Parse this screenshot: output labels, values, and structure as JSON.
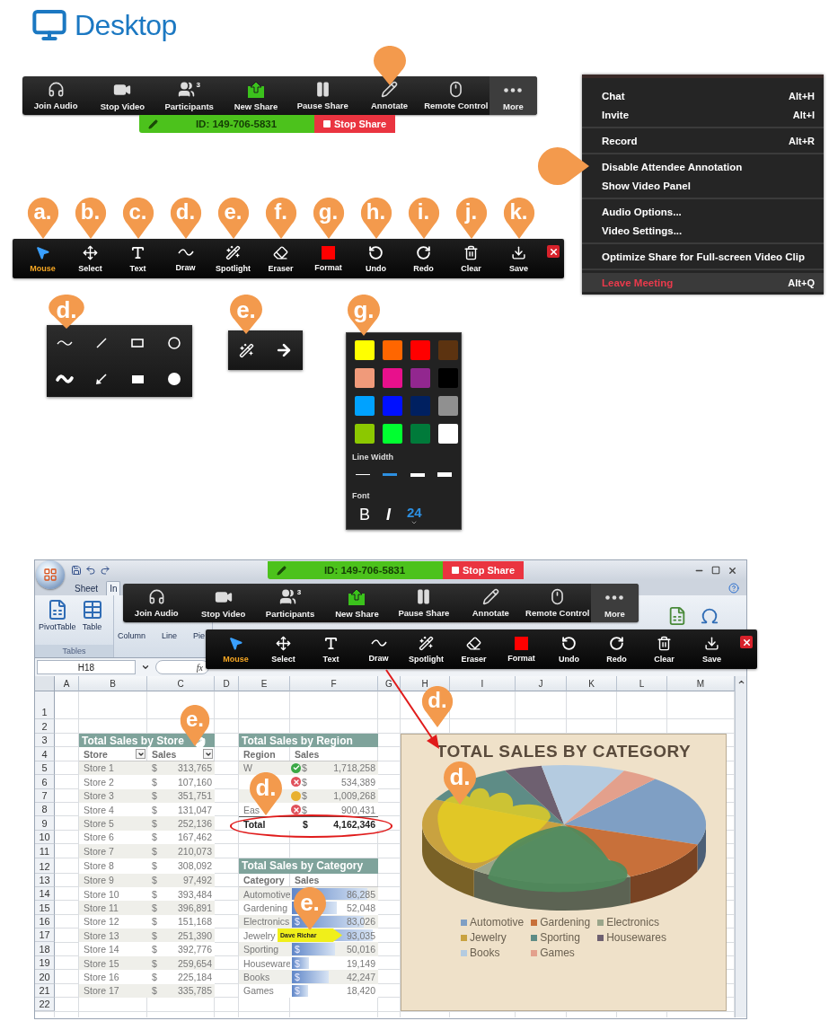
{
  "header": {
    "title": "Desktop"
  },
  "meeting_toolbar": {
    "buttons": [
      {
        "kind": "audio",
        "label": "Join Audio",
        "active": false,
        "marked": false
      },
      {
        "kind": "video",
        "label": "Stop Video",
        "active": false,
        "marked": false
      },
      {
        "kind": "participants",
        "label": "Participants",
        "count": "3",
        "active": false,
        "marked": false
      },
      {
        "kind": "share",
        "label": "New Share",
        "active": false,
        "marked": false
      },
      {
        "kind": "pause",
        "label": "Pause Share",
        "active": false,
        "marked": false
      },
      {
        "kind": "annotate",
        "label": "Annotate",
        "active": false,
        "marked": true
      },
      {
        "kind": "remote",
        "label": "Remote Control",
        "active": false,
        "marked": false
      },
      {
        "kind": "more",
        "label": "More",
        "active": true,
        "marked": false
      }
    ]
  },
  "share_bar": {
    "meeting_id": "ID: 149-706-5831",
    "stop_label": "Stop Share"
  },
  "more_menu": {
    "groups": [
      [
        {
          "label": "Chat",
          "shortcut": "Alt+H",
          "kind": "normal",
          "marked": false
        },
        {
          "label": "Invite",
          "shortcut": "Alt+I",
          "kind": "normal",
          "marked": false
        }
      ],
      [
        {
          "label": "Record",
          "shortcut": "Alt+R",
          "kind": "normal",
          "marked": false
        }
      ],
      [
        {
          "label": "Disable Attendee Annotation",
          "kind": "normal",
          "marked": true
        },
        {
          "label": "Show Video Panel",
          "kind": "normal",
          "marked": false
        }
      ],
      [
        {
          "label": "Audio Options...",
          "kind": "normal",
          "marked": false
        },
        {
          "label": "Video Settings...",
          "kind": "normal",
          "marked": false
        }
      ],
      [
        {
          "label": "Optimize Share for Full-screen Video Clip",
          "kind": "normal",
          "marked": false
        }
      ],
      [
        {
          "label": "Leave Meeting",
          "shortcut": "Alt+Q",
          "kind": "danger",
          "marked": false
        }
      ]
    ]
  },
  "annotation_toolbar": {
    "tools": [
      {
        "kind": "mouse",
        "label": "Mouse",
        "callout": "a.",
        "selected": true
      },
      {
        "kind": "select",
        "label": "Select",
        "callout": "b.",
        "selected": false
      },
      {
        "kind": "text",
        "label": "Text",
        "callout": "c.",
        "selected": false
      },
      {
        "kind": "draw",
        "label": "Draw",
        "callout": "d.",
        "selected": false
      },
      {
        "kind": "spotlight",
        "label": "Spotlight",
        "callout": "e.",
        "selected": false
      },
      {
        "kind": "eraser",
        "label": "Eraser",
        "callout": "f.",
        "selected": false
      },
      {
        "kind": "format",
        "label": "Format",
        "callout": "g.",
        "selected": false
      },
      {
        "kind": "undo",
        "label": "Undo",
        "callout": "h.",
        "selected": false
      },
      {
        "kind": "redo",
        "label": "Redo",
        "callout": "i.",
        "selected": false
      },
      {
        "kind": "clear",
        "label": "Clear",
        "callout": "j.",
        "selected": false
      },
      {
        "kind": "save",
        "label": "Save",
        "callout": "k.",
        "selected": false
      }
    ]
  },
  "draw_panel": {
    "callout": "d.",
    "tools": [
      {
        "kind": "wave"
      },
      {
        "kind": "line"
      },
      {
        "kind": "rectangle"
      },
      {
        "kind": "ellipse"
      },
      {
        "kind": "wave-filled"
      },
      {
        "kind": "arrow"
      },
      {
        "kind": "rectangle-filled"
      },
      {
        "kind": "ellipse-filled"
      }
    ]
  },
  "spotlight_panel": {
    "callout": "e.",
    "tools": [
      {
        "kind": "spotlight"
      },
      {
        "kind": "arrow"
      }
    ]
  },
  "format_panel": {
    "callout": "g.",
    "colors": [
      {
        "color": "#ffff00"
      },
      {
        "color": "#ff6600"
      },
      {
        "color": "#ff0000"
      },
      {
        "color": "#5c3310"
      },
      {
        "color": "#f09a7a"
      },
      {
        "color": "#e8108c"
      },
      {
        "color": "#92278f"
      },
      {
        "color": "#000000"
      },
      {
        "color": "#00a2ff"
      },
      {
        "color": "#0010ff"
      },
      {
        "color": "#002060"
      },
      {
        "color": "#909090"
      },
      {
        "color": "#8cc800"
      },
      {
        "color": "#00ff30"
      },
      {
        "color": "#007a3a"
      },
      {
        "color": "#ffffff"
      }
    ],
    "line_width_label": "Line Width",
    "line_widths": [
      {
        "selected": false
      },
      {
        "selected": true
      },
      {
        "selected": false
      },
      {
        "selected": false
      }
    ],
    "font_label": "Font",
    "bold": "B",
    "italic": "I",
    "size": "24"
  },
  "spreadsheet": {
    "share_bar": {
      "meeting_id": "ID: 149-706-5831",
      "stop_label": "Stop Share"
    },
    "tabs": [
      {
        "label": "Sheet",
        "selected": false
      },
      {
        "label": "In",
        "selected": true
      }
    ],
    "ribbon": {
      "buttons": [
        {
          "kind": "pivot",
          "label": "PivotTable"
        },
        {
          "kind": "table",
          "label": "Table"
        }
      ],
      "group_label": "Tables",
      "chart_buttons": [
        "Column",
        "Line",
        "Pie"
      ]
    },
    "meeting_toolbar": {
      "buttons": [
        {
          "kind": "audio",
          "label": "Join Audio",
          "active": false,
          "marked": false
        },
        {
          "kind": "video",
          "label": "Stop Video",
          "active": false,
          "marked": false
        },
        {
          "kind": "participants",
          "label": "Participants",
          "count": "3",
          "active": false,
          "marked": false
        },
        {
          "kind": "share",
          "label": "New Share",
          "active": false,
          "marked": false
        },
        {
          "kind": "pause",
          "label": "Pause Share",
          "active": false,
          "marked": false
        },
        {
          "kind": "annotate",
          "label": "Annotate",
          "active": false,
          "marked": false
        },
        {
          "kind": "remote",
          "label": "Remote Control",
          "active": false,
          "marked": false
        },
        {
          "kind": "more",
          "label": "More",
          "active": true,
          "marked": false
        }
      ]
    },
    "annotation_toolbar": {
      "tools": [
        {
          "kind": "mouse",
          "label": "Mouse",
          "selected": true
        },
        {
          "kind": "select",
          "label": "Select",
          "selected": false
        },
        {
          "kind": "text",
          "label": "Text",
          "selected": false
        },
        {
          "kind": "draw",
          "label": "Draw",
          "selected": false
        },
        {
          "kind": "spotlight",
          "label": "Spotlight",
          "selected": false
        },
        {
          "kind": "eraser",
          "label": "Eraser",
          "selected": false
        },
        {
          "kind": "format",
          "label": "Format",
          "selected": false
        },
        {
          "kind": "undo",
          "label": "Undo",
          "selected": false
        },
        {
          "kind": "redo",
          "label": "Redo",
          "selected": false
        },
        {
          "kind": "clear",
          "label": "Clear",
          "selected": false
        },
        {
          "kind": "save",
          "label": "Save",
          "selected": false
        }
      ]
    },
    "name_box": "H18",
    "formula_label": "fx",
    "columns": [
      "A",
      "B",
      "C",
      "D",
      "E",
      "F",
      "G",
      "H",
      "I",
      "J",
      "K",
      "L",
      "M"
    ],
    "rows": [
      "1",
      "2",
      "3",
      "4",
      "5",
      "6",
      "7",
      "8",
      "9",
      "10",
      "11",
      "12",
      "13",
      "14",
      "15",
      "16",
      "17",
      "18",
      "19",
      "20",
      "21",
      "22"
    ],
    "store_table": {
      "title": "Total Sales by Store",
      "callout": "e.",
      "headers": [
        "Store",
        "Sales"
      ],
      "rows": [
        {
          "name": "Store 1",
          "currency": "$",
          "value": "313,765"
        },
        {
          "name": "Store 2",
          "currency": "$",
          "value": "107,160"
        },
        {
          "name": "Store 3",
          "currency": "$",
          "value": "351,751"
        },
        {
          "name": "Store 4",
          "currency": "$",
          "value": "131,047"
        },
        {
          "name": "Store 5",
          "currency": "$",
          "value": "252,136"
        },
        {
          "name": "Store 6",
          "currency": "$",
          "value": "167,462"
        },
        {
          "name": "Store 7",
          "currency": "$",
          "value": "210,073"
        },
        {
          "name": "Store 8",
          "currency": "$",
          "value": "308,092"
        },
        {
          "name": "Store 9",
          "currency": "$",
          "value": "97,492"
        },
        {
          "name": "Store 10",
          "currency": "$",
          "value": "393,484"
        },
        {
          "name": "Store 11",
          "currency": "$",
          "value": "396,891"
        },
        {
          "name": "Store 12",
          "currency": "$",
          "value": "151,168"
        },
        {
          "name": "Store 13",
          "currency": "$",
          "value": "251,390"
        },
        {
          "name": "Store 14",
          "currency": "$",
          "value": "392,776"
        },
        {
          "name": "Store 15",
          "currency": "$",
          "value": "259,654"
        },
        {
          "name": "Store 16",
          "currency": "$",
          "value": "225,184"
        },
        {
          "name": "Store 17",
          "currency": "$",
          "value": "335,785"
        }
      ]
    },
    "region_table": {
      "title": "Total Sales by Region",
      "callout": "d.",
      "headers": [
        "Region",
        "Sales"
      ],
      "rows": [
        {
          "region": "W",
          "kind": "good",
          "currency": "$",
          "value": "1,718,258"
        },
        {
          "kind": "bad",
          "currency": "$",
          "value": "534,389"
        },
        {
          "kind": "warning",
          "currency": "$",
          "value": "1,009,268"
        },
        {
          "region": "Eas",
          "kind": "bad",
          "currency": "$",
          "value": "900,431"
        }
      ],
      "total": {
        "label": "Total",
        "currency": "$",
        "value": "4,162,346",
        "circled": true
      }
    },
    "category_table": {
      "title": "Total Sales by Category",
      "callout": "e.",
      "headers": [
        "Category",
        "Sales"
      ],
      "rows": [
        {
          "name": "Automotive",
          "value": "86,285"
        },
        {
          "name": "Gardening",
          "value": "52,048"
        },
        {
          "name": "Electronics",
          "currency": "$",
          "value": "83,026"
        },
        {
          "name": "Jewelry",
          "value": "93,035",
          "pointer": "Dave Richar"
        },
        {
          "name": "Sporting",
          "currency": "$",
          "value": "50,016"
        },
        {
          "name": "Houseware",
          "currency": "$",
          "value": "19,149"
        },
        {
          "name": "Books",
          "currency": "$",
          "value": "42,247"
        },
        {
          "name": "Games",
          "currency": "$",
          "value": "18,420"
        }
      ]
    },
    "chart": {
      "title": "TOTAL SALES BY CATEGORY",
      "callouts": [
        "d.",
        "d."
      ],
      "arrow": true,
      "legend": [
        {
          "label": "Automotive",
          "color": "#7f9fc4"
        },
        {
          "label": "Gardening",
          "color": "#c8703a"
        },
        {
          "label": "Electronics",
          "color": "#9aa58a"
        },
        {
          "label": "Jewelry",
          "color": "#c9a240"
        },
        {
          "label": "Sporting",
          "color": "#5e8c86"
        },
        {
          "label": "Housewares",
          "color": "#6e6070"
        },
        {
          "label": "Books",
          "color": "#b4cbe0"
        },
        {
          "label": "Games",
          "color": "#e3a08c"
        }
      ]
    }
  }
}
